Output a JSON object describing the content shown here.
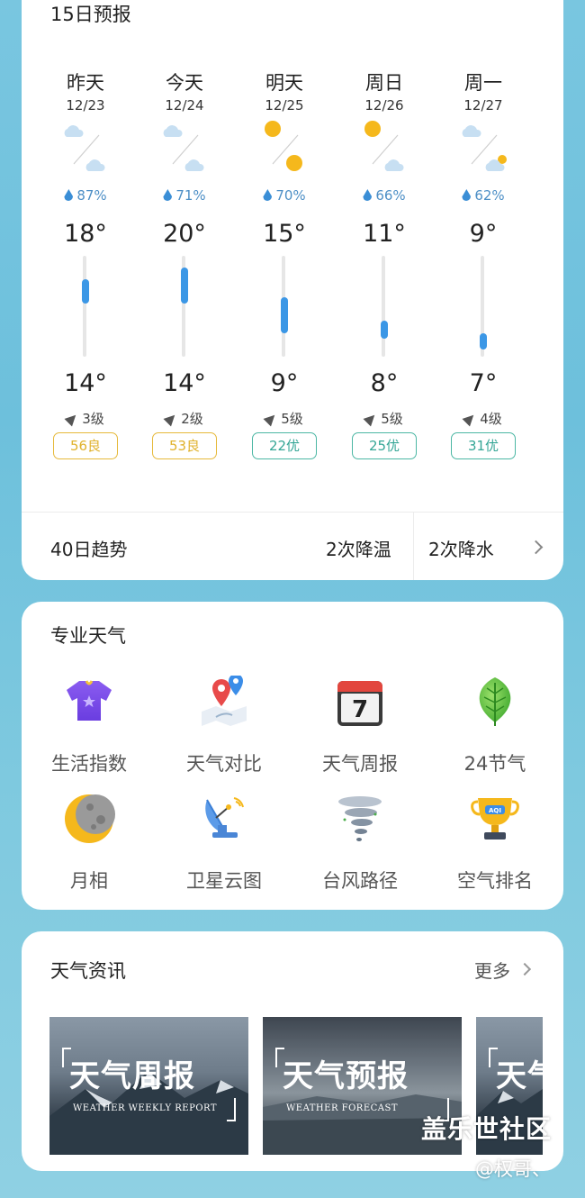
{
  "forecast": {
    "title": "15日预报",
    "days": [
      {
        "label": "昨天",
        "date": "12/23",
        "precip": "87%",
        "high": "18°",
        "low": "14°",
        "wind": "3级",
        "aqi": "56良",
        "aqi_level": "good",
        "icon_day": "cloudy-icon",
        "icon_night": "cloudy-icon",
        "range": [
          14,
          18
        ]
      },
      {
        "label": "今天",
        "date": "12/24",
        "precip": "71%",
        "high": "20°",
        "low": "14°",
        "wind": "2级",
        "aqi": "53良",
        "aqi_level": "good",
        "icon_day": "cloudy-icon",
        "icon_night": "cloudy-icon",
        "range": [
          14,
          20
        ]
      },
      {
        "label": "明天",
        "date": "12/25",
        "precip": "70%",
        "high": "15°",
        "low": "9°",
        "wind": "5级",
        "aqi": "22优",
        "aqi_level": "excellent",
        "icon_day": "sunny-icon",
        "icon_night": "sunny-icon",
        "range": [
          9,
          15
        ]
      },
      {
        "label": "周日",
        "date": "12/26",
        "precip": "66%",
        "high": "11°",
        "low": "8°",
        "wind": "5级",
        "aqi": "25优",
        "aqi_level": "excellent",
        "icon_day": "sunny-icon",
        "icon_night": "cloudy-icon",
        "range": [
          8,
          11
        ]
      },
      {
        "label": "周一",
        "date": "12/27",
        "precip": "62%",
        "high": "9°",
        "low": "7°",
        "wind": "4级",
        "aqi": "31优",
        "aqi_level": "excellent",
        "icon_day": "cloudy-icon",
        "icon_night": "partly-cloudy-icon",
        "range": [
          7,
          9
        ]
      }
    ],
    "trend_label": "40日趋势",
    "trend_cooling": "2次降温",
    "trend_rain": "2次降水"
  },
  "pro": {
    "title": "专业天气",
    "items": [
      {
        "label": "生活指数",
        "icon": "tshirt-icon"
      },
      {
        "label": "天气对比",
        "icon": "map-pins-icon"
      },
      {
        "label": "天气周报",
        "icon": "calendar-icon"
      },
      {
        "label": "24节气",
        "icon": "leaf-icon"
      },
      {
        "label": "月相",
        "icon": "moon-icon"
      },
      {
        "label": "卫星云图",
        "icon": "satellite-dish-icon"
      },
      {
        "label": "台风路径",
        "icon": "tornado-icon"
      },
      {
        "label": "空气排名",
        "icon": "trophy-icon"
      }
    ]
  },
  "news": {
    "title": "天气资讯",
    "more": "更多",
    "items": [
      {
        "title": "天气周报",
        "subtitle": "WEATHER WEEKLY REPORT"
      },
      {
        "title": "天气预报",
        "subtitle": "WEATHER FORECAST"
      },
      {
        "title": "天气",
        "subtitle": ""
      }
    ]
  },
  "watermark": {
    "main": "盖乐世社区",
    "sub": "@权哥、"
  },
  "colors": {
    "accent_blue": "#3b97e6",
    "aqi_good": "#e0b22c",
    "aqi_excellent": "#35a696"
  }
}
